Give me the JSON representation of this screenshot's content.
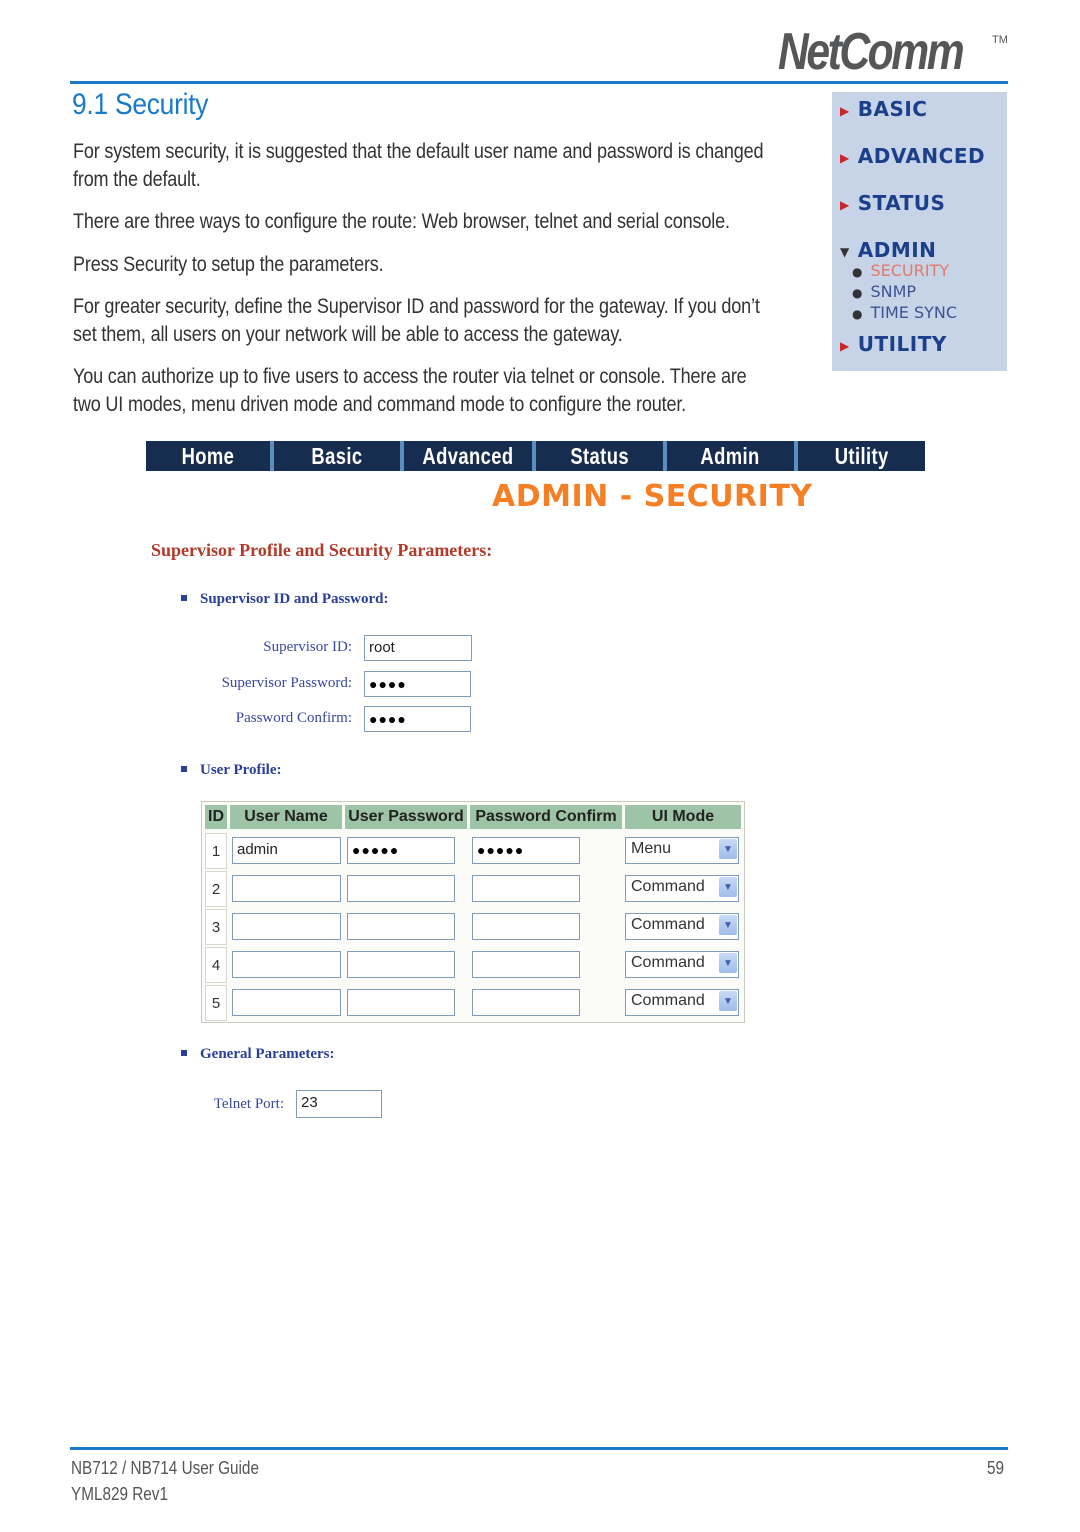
{
  "brand": {
    "logo_text": "NetComm",
    "trademark": "TM"
  },
  "heading": "9.1 Security",
  "paragraphs": [
    "For system security, it is suggested that the default user name and password is changed from the default.",
    "There are three ways to configure the route: Web browser, telnet and serial console.",
    "Press Security to setup the parameters.",
    "For greater security, define the Supervisor ID and password for the gateway. If you don’t set them, all users on your network will be able to access the gateway.",
    "You can authorize up to five users to access the router via telnet or console. There are two UI modes, menu driven mode and command mode to configure the router."
  ],
  "side_menu": {
    "items": [
      {
        "label": "BASIC",
        "expanded": false
      },
      {
        "label": "ADVANCED",
        "expanded": false
      },
      {
        "label": "STATUS",
        "expanded": false
      },
      {
        "label": "ADMIN",
        "expanded": true
      },
      {
        "label": "UTILITY",
        "expanded": false
      }
    ],
    "admin_sub": [
      {
        "label": "SECURITY",
        "active": true
      },
      {
        "label": "SNMP",
        "active": false
      },
      {
        "label": "TIME SYNC",
        "active": false
      }
    ]
  },
  "nav_tabs": [
    "Home",
    "Basic",
    "Advanced",
    "Status",
    "Admin",
    "Utility"
  ],
  "page_title": "ADMIN - SECURITY",
  "section_title": "Supervisor Profile and Security Parameters:",
  "supervisor": {
    "heading": "Supervisor ID and Password:",
    "id_label": "Supervisor ID:",
    "id_value": "root",
    "password_label": "Supervisor Password:",
    "password_value": "●●●●",
    "confirm_label": "Password Confirm:",
    "confirm_value": "●●●●"
  },
  "user_profile": {
    "heading": "User Profile:",
    "columns": [
      "ID",
      "User Name",
      "User Password",
      "Password Confirm",
      "UI Mode"
    ],
    "rows": [
      {
        "id": "1",
        "user_name": "admin",
        "password": "●●●●●",
        "confirm": "●●●●●",
        "ui_mode": "Menu"
      },
      {
        "id": "2",
        "user_name": "",
        "password": "",
        "confirm": "",
        "ui_mode": "Command"
      },
      {
        "id": "3",
        "user_name": "",
        "password": "",
        "confirm": "",
        "ui_mode": "Command"
      },
      {
        "id": "4",
        "user_name": "",
        "password": "",
        "confirm": "",
        "ui_mode": "Command"
      },
      {
        "id": "5",
        "user_name": "",
        "password": "",
        "confirm": "",
        "ui_mode": "Command"
      }
    ]
  },
  "general": {
    "heading": "General Parameters:",
    "telnet_label": "Telnet Port:",
    "telnet_value": "23"
  },
  "footer": {
    "guide": "NB712 / NB714 User Guide",
    "revision": "YML829 Rev1",
    "page_number": "59"
  },
  "colors": {
    "accent_blue": "#1a7ac8",
    "nav_dark": "#172d4f",
    "title_orange": "#f47f24",
    "section_red": "#b23a2a",
    "table_header_green": "#9dc4a6",
    "side_menu_bg": "#c7d4e8"
  }
}
